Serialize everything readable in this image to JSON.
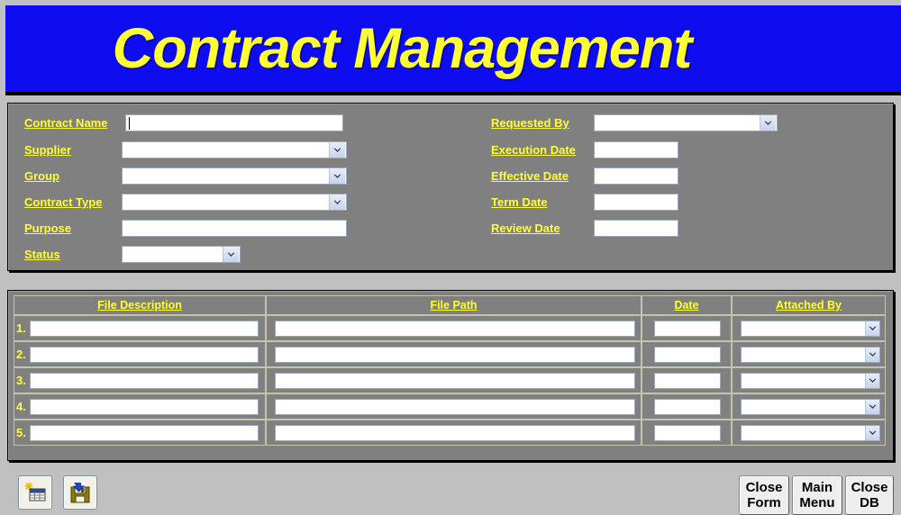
{
  "banner": {
    "title": "Contract Management",
    "bg_color": "#0d0df0",
    "text_color": "#ffff33"
  },
  "form": {
    "left_fields": [
      {
        "label": "Contract Name",
        "type": "text",
        "value": "",
        "focused": true
      },
      {
        "label": "Supplier",
        "type": "combo",
        "value": ""
      },
      {
        "label": "Group",
        "type": "combo",
        "value": ""
      },
      {
        "label": "Contract Type",
        "type": "combo",
        "value": ""
      },
      {
        "label": "Purpose",
        "type": "text",
        "value": ""
      },
      {
        "label": "Status",
        "type": "combo",
        "value": ""
      }
    ],
    "right_fields": [
      {
        "label": "Requested By",
        "type": "combo",
        "value": ""
      },
      {
        "label": "Execution Date",
        "type": "text",
        "value": ""
      },
      {
        "label": "Effective Date",
        "type": "text",
        "value": ""
      },
      {
        "label": "Term Date",
        "type": "text",
        "value": ""
      },
      {
        "label": "Review Date",
        "type": "text",
        "value": ""
      }
    ]
  },
  "attachments": {
    "columns": [
      "File Description",
      "File Path",
      "Date",
      "Attached By"
    ],
    "rows": [
      {
        "num": "1.",
        "file_description": "",
        "file_path": "",
        "date": "",
        "attached_by": ""
      },
      {
        "num": "2.",
        "file_description": "",
        "file_path": "",
        "date": "",
        "attached_by": ""
      },
      {
        "num": "3.",
        "file_description": "",
        "file_path": "",
        "date": "",
        "attached_by": ""
      },
      {
        "num": "4.",
        "file_description": "",
        "file_path": "",
        "date": "",
        "attached_by": ""
      },
      {
        "num": "5.",
        "file_description": "",
        "file_path": "",
        "date": "",
        "attached_by": ""
      }
    ]
  },
  "footer": {
    "icon_buttons": [
      {
        "name": "new-record-icon",
        "title": "New Record"
      },
      {
        "name": "save-record-icon",
        "title": "Save Record"
      }
    ],
    "buttons": [
      {
        "line1": "Close",
        "line2": "Form"
      },
      {
        "line1": "Main",
        "line2": "Menu"
      },
      {
        "line1": "Close",
        "line2": "DB"
      }
    ]
  }
}
